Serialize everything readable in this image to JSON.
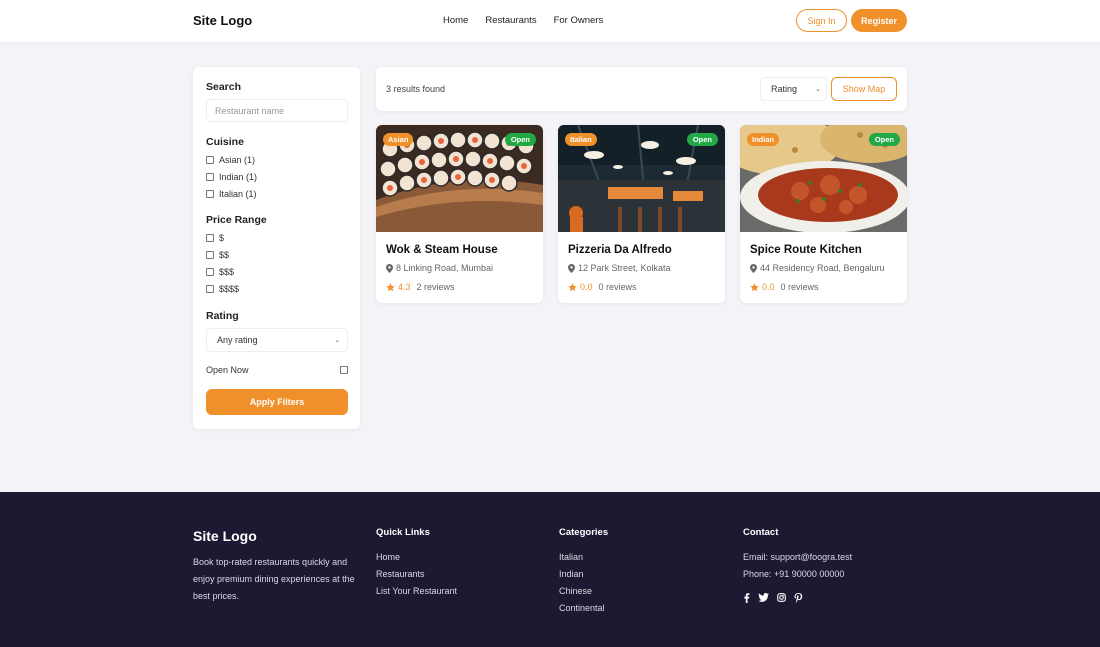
{
  "header": {
    "logo": "Site Logo",
    "nav": [
      "Home",
      "Restaurants",
      "For Owners"
    ],
    "sign_in": "Sign In",
    "register": "Register"
  },
  "filters": {
    "search_title": "Search",
    "search_placeholder": "Restaurant name",
    "cuisine_title": "Cuisine",
    "cuisines": [
      "Asian (1)",
      "Indian (1)",
      "Italian (1)"
    ],
    "price_title": "Price Range",
    "prices": [
      "$",
      "$$",
      "$$$",
      "$$$$"
    ],
    "rating_title": "Rating",
    "rating_value": "Any rating",
    "open_now": "Open Now",
    "apply": "Apply Filters"
  },
  "results": {
    "count": "3 results found",
    "sort_value": "Rating",
    "show_map": "Show Map"
  },
  "restaurants": [
    {
      "name": "Wok & Steam House",
      "cuisine": "Asian",
      "status": "Open",
      "address": "8 Linking Road, Mumbai",
      "rating": "4.3",
      "reviews": "2 reviews"
    },
    {
      "name": "Pizzeria Da Alfredo",
      "cuisine": "Italian",
      "status": "Open",
      "address": "12 Park Street, Kolkata",
      "rating": "0.0",
      "reviews": "0 reviews"
    },
    {
      "name": "Spice Route Kitchen",
      "cuisine": "Indian",
      "status": "Open",
      "address": "44 Residency Road, Bengaluru",
      "rating": "0.0",
      "reviews": "0 reviews"
    }
  ],
  "footer": {
    "logo": "Site Logo",
    "description": "Book top-rated restaurants quickly and enjoy premium dining experiences at the best prices.",
    "quick_links_title": "Quick Links",
    "quick_links": [
      "Home",
      "Restaurants",
      "List Your Restaurant"
    ],
    "categories_title": "Categories",
    "categories": [
      "Italian",
      "Indian",
      "Chinese",
      "Continental"
    ],
    "contact_title": "Contact",
    "email": "Email: support@foogra.test",
    "phone": "Phone: +91 90000 00000",
    "social_icons": [
      "facebook-icon",
      "twitter-icon",
      "instagram-icon",
      "pinterest-icon"
    ]
  },
  "colors": {
    "accent": "#f0902a",
    "open": "#22a845",
    "footer_bg": "#1c1a33",
    "page_bg": "#f4f4f8"
  }
}
